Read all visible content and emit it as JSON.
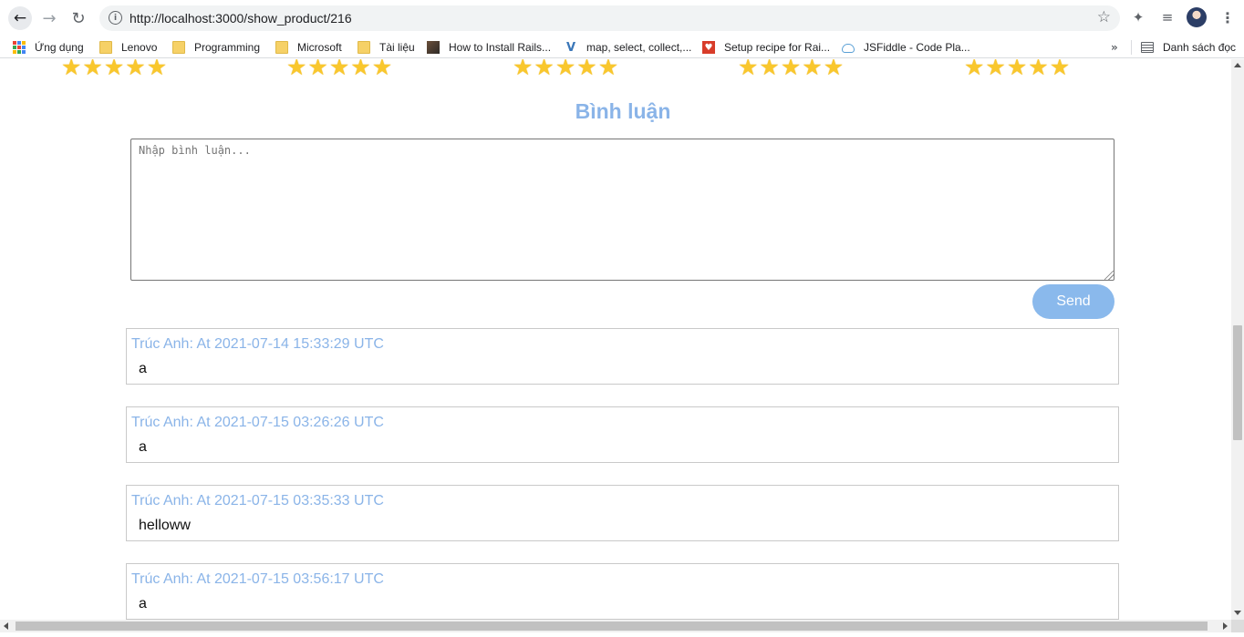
{
  "browser": {
    "url": "http://localhost:3000/show_product/216",
    "icons": {
      "back": "arrow-left-icon",
      "forward": "arrow-right-icon",
      "reload": "reload-icon",
      "site_info": "info-icon",
      "bookmark_star": "star-outline-icon",
      "extensions": "puzzle-icon",
      "media": "media-queue-icon",
      "menu": "more-vertical-icon"
    }
  },
  "bookmarks": {
    "items": [
      {
        "label": "Ứng dụng",
        "icon": "apps-grid-icon"
      },
      {
        "label": "Lenovo",
        "icon": "folder-icon"
      },
      {
        "label": "Programming",
        "icon": "folder-icon"
      },
      {
        "label": "Microsoft",
        "icon": "folder-icon"
      },
      {
        "label": "Tài liệu",
        "icon": "folder-icon"
      },
      {
        "label": "How to Install Rails...",
        "icon": "rails-favicon"
      },
      {
        "label": "map, select, collect,...",
        "icon": "v-favicon"
      },
      {
        "label": "Setup recipe for Rai...",
        "icon": "recipe-favicon"
      },
      {
        "label": "JSFiddle - Code Pla...",
        "icon": "jsfiddle-favicon"
      }
    ],
    "more": "»",
    "reading_list": "Danh sách đọc"
  },
  "page": {
    "rating_rows": [
      5,
      5,
      5,
      5,
      5
    ],
    "star_color": "#f9c72d",
    "heading": "Bình luận",
    "accent_color": "#8ab4e8",
    "comment_placeholder": "Nhập bình luận...",
    "send_label": "Send",
    "send_color": "#8ab9ec",
    "comments": [
      {
        "meta": "Trúc Anh: At 2021-07-14 15:33:29 UTC",
        "body": "a"
      },
      {
        "meta": "Trúc Anh: At 2021-07-15 03:26:26 UTC",
        "body": "a"
      },
      {
        "meta": "Trúc Anh: At 2021-07-15 03:35:33 UTC",
        "body": "helloww"
      },
      {
        "meta": "Trúc Anh: At 2021-07-15 03:56:17 UTC",
        "body": "a"
      }
    ]
  }
}
